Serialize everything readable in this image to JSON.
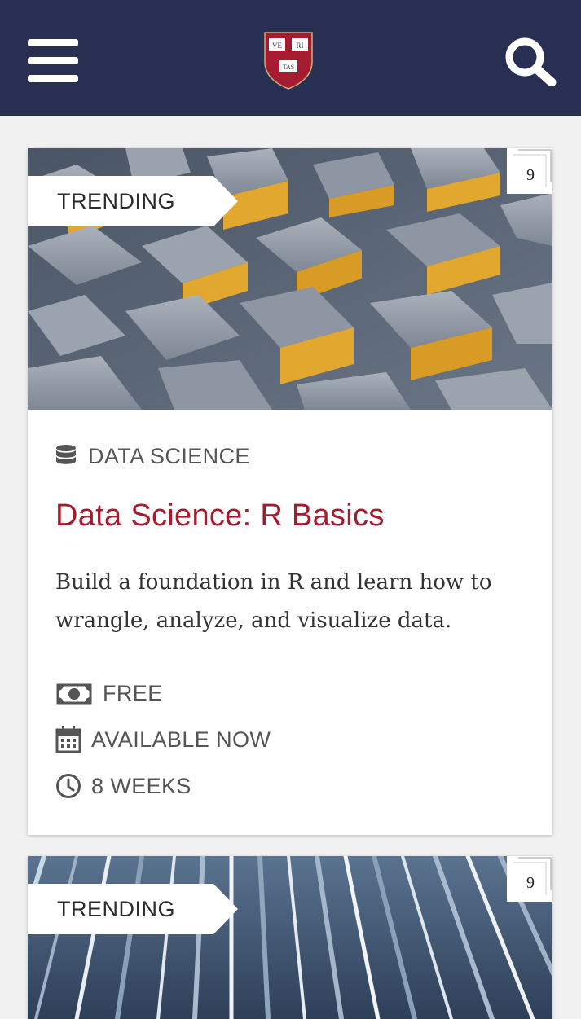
{
  "header": {
    "menu_icon": "hamburger-icon",
    "logo": {
      "name": "harvard-shield-logo",
      "letters": [
        "VE",
        "RI",
        "TAS"
      ]
    },
    "search_icon": "search-icon",
    "color": "#282f52"
  },
  "courses": [
    {
      "badge": "TRENDING",
      "corner_number": "9",
      "category": {
        "icon": "database-icon",
        "label": "DATA SCIENCE"
      },
      "title": "Data Science: R Basics",
      "description": "Build a foundation in R and learn how to wrangle, analyze, and visualize data.",
      "meta": [
        {
          "icon": "money-icon",
          "label": "FREE"
        },
        {
          "icon": "calendar-icon",
          "label": "AVAILABLE NOW"
        },
        {
          "icon": "clock-icon",
          "label": "8 WEEKS"
        }
      ]
    },
    {
      "badge": "TRENDING",
      "corner_number": "9"
    }
  ],
  "colors": {
    "accent": "#a51c30",
    "header": "#282f52",
    "gold": "#e2a72e"
  }
}
